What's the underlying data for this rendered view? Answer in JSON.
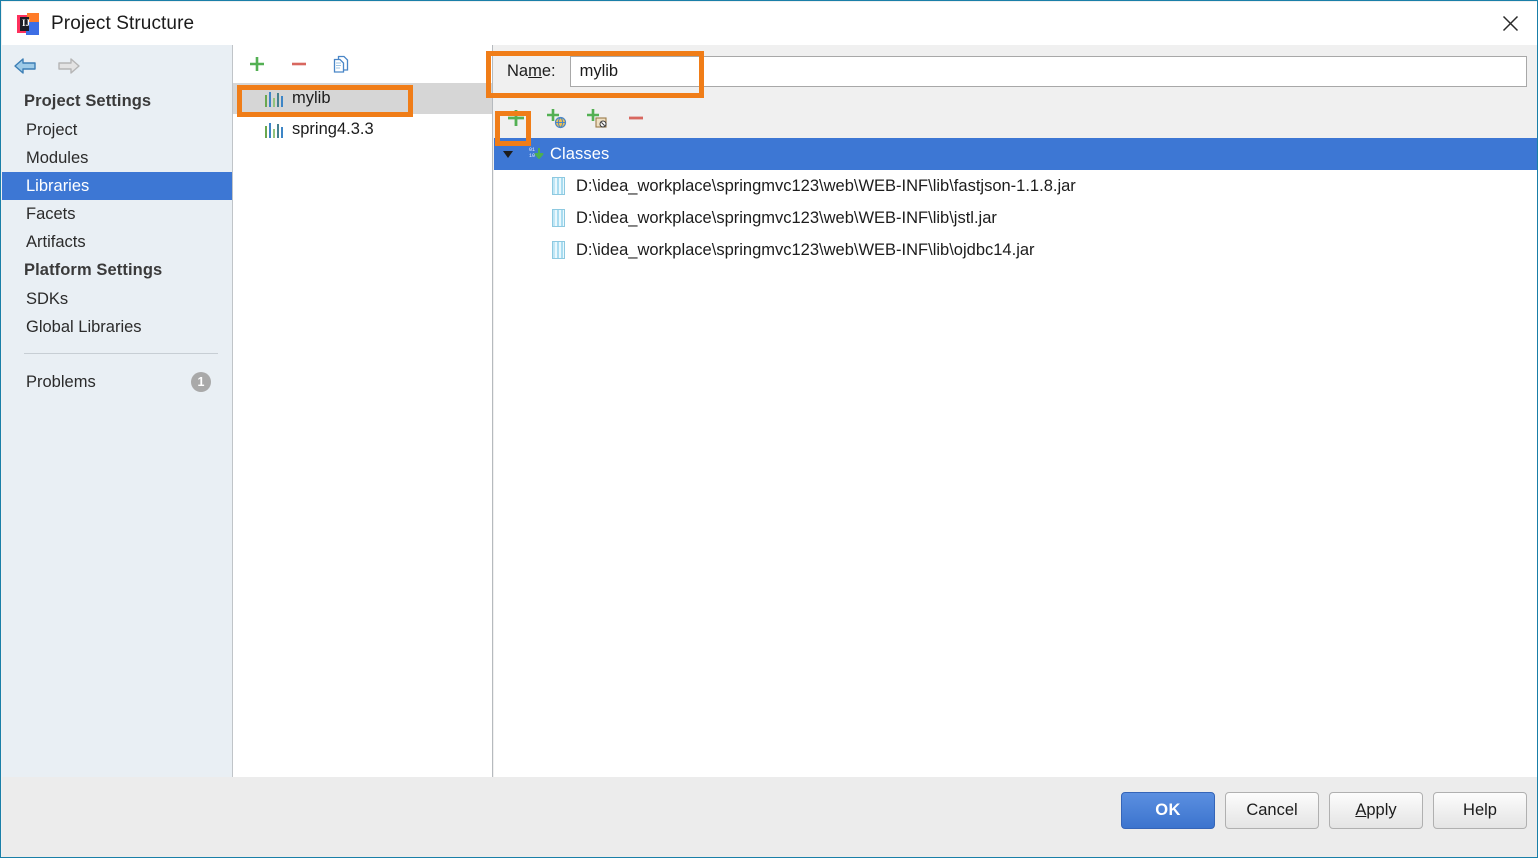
{
  "window": {
    "title": "Project Structure",
    "logo_letters": "IJ",
    "close_icon": "close-icon"
  },
  "sidebar": {
    "nav": {
      "back_icon": "arrow-left-icon",
      "forward_icon": "arrow-right-icon"
    },
    "groups": [
      {
        "label": "Project Settings",
        "items": [
          {
            "label": "Project",
            "selected": false
          },
          {
            "label": "Modules",
            "selected": false
          },
          {
            "label": "Libraries",
            "selected": true
          },
          {
            "label": "Facets",
            "selected": false
          },
          {
            "label": "Artifacts",
            "selected": false
          }
        ]
      },
      {
        "label": "Platform Settings",
        "items": [
          {
            "label": "SDKs",
            "selected": false
          },
          {
            "label": "Global Libraries",
            "selected": false
          }
        ]
      }
    ],
    "problems": {
      "label": "Problems",
      "count": "1"
    }
  },
  "library_list": {
    "toolbar": [
      {
        "name": "add-library-button",
        "icon": "plus-icon",
        "tooltip": "Add"
      },
      {
        "name": "remove-library-button",
        "icon": "minus-icon",
        "tooltip": "Remove"
      },
      {
        "name": "copy-library-button",
        "icon": "copy-icon",
        "tooltip": "Copy"
      }
    ],
    "items": [
      {
        "label": "mylib",
        "selected": true
      },
      {
        "label": "spring4.3.3",
        "selected": false
      }
    ]
  },
  "detail": {
    "name_label": "Name:",
    "name_mnemonic": "m",
    "name_value": "mylib",
    "name_placeholder": "",
    "roots_toolbar": [
      {
        "name": "add-root-button",
        "icon": "plus-icon",
        "tooltip": "Add"
      },
      {
        "name": "add-from-url-button",
        "icon": "plus-globe-icon",
        "tooltip": "Add from URL"
      },
      {
        "name": "add-from-module-button",
        "icon": "plus-package-icon",
        "tooltip": "Add from module"
      },
      {
        "name": "remove-root-button",
        "icon": "minus-icon",
        "tooltip": "Remove"
      }
    ],
    "tree": {
      "root": {
        "label": "Classes",
        "icon": "classes-download-icon",
        "expander": "triangle-down-icon",
        "selected": true
      },
      "entries": [
        {
          "icon": "jar-icon",
          "path": "D:\\idea_workplace\\springmvc123\\web\\WEB-INF\\lib\\fastjson-1.1.8.jar"
        },
        {
          "icon": "jar-icon",
          "path": "D:\\idea_workplace\\springmvc123\\web\\WEB-INF\\lib\\jstl.jar"
        },
        {
          "icon": "jar-icon",
          "path": "D:\\idea_workplace\\springmvc123\\web\\WEB-INF\\lib\\ojdbc14.jar"
        }
      ]
    }
  },
  "footer": {
    "buttons": [
      {
        "label": "OK",
        "primary": true,
        "mnemonic": ""
      },
      {
        "label": "Cancel",
        "primary": false,
        "mnemonic": ""
      },
      {
        "label": "Apply",
        "primary": false,
        "mnemonic": "A"
      },
      {
        "label": "Help",
        "primary": false,
        "mnemonic": ""
      }
    ]
  },
  "annotations": {
    "accent_color": "#f07d18",
    "boxes": [
      {
        "name": "mylib-row-highlight"
      },
      {
        "name": "name-field-highlight"
      },
      {
        "name": "add-root-button-highlight"
      }
    ]
  }
}
